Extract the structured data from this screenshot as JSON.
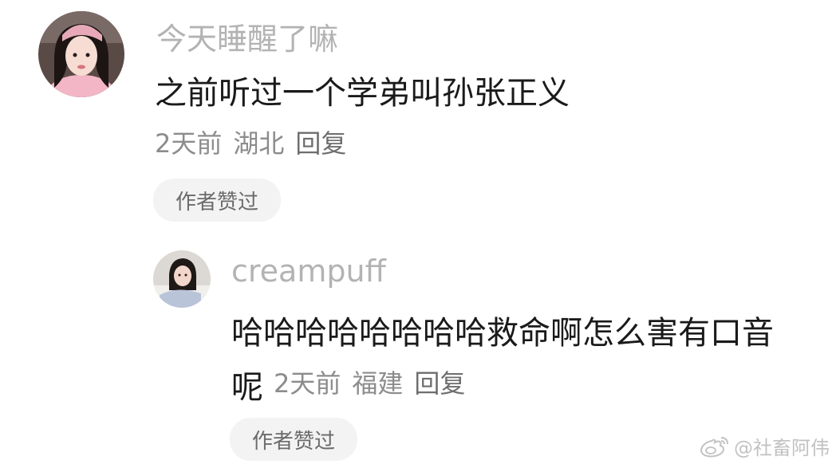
{
  "comments": [
    {
      "username": "今天睡醒了嘛",
      "text": "之前听过一个学弟叫孙张正义",
      "time": "2天前",
      "location": "湖北",
      "reply_label": "回复",
      "badge": "作者赞过",
      "avatar_icon": "user-avatar-girl-pink"
    },
    {
      "username": "creampuff",
      "text_line1": "哈哈哈哈哈哈哈哈救命啊怎么害有口音",
      "text_line2": "呢",
      "time": "2天前",
      "location": "福建",
      "reply_label": "回复",
      "badge": "作者赞过",
      "avatar_icon": "user-avatar-girl-bed"
    }
  ],
  "watermark": {
    "text": "@社畜阿伟",
    "icon": "weibo-icon"
  },
  "colors": {
    "username": "#b3b3b3",
    "text": "#1a1a1a",
    "meta": "#8c8c8c",
    "badge_bg": "#f3f3f3"
  }
}
